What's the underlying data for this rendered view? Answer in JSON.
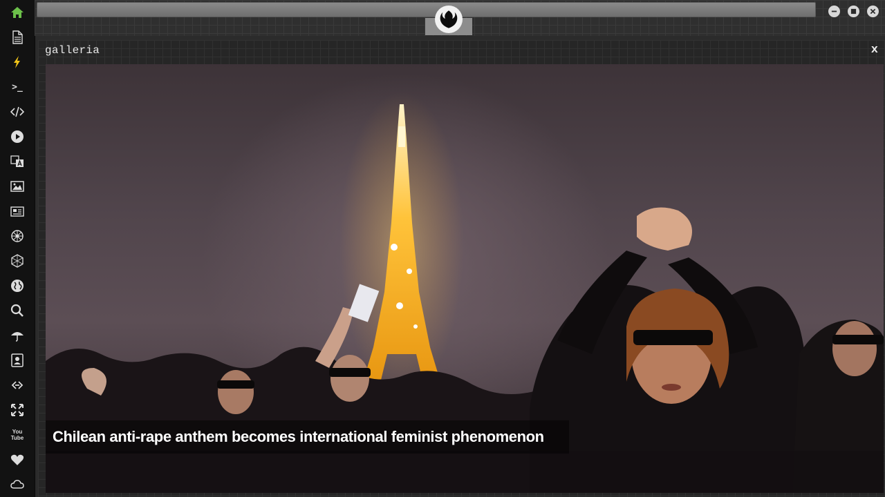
{
  "dock": {
    "items": [
      {
        "name": "home-icon",
        "active": true
      },
      {
        "name": "document-icon"
      },
      {
        "name": "lightning-icon"
      },
      {
        "name": "terminal-icon",
        "text": ">_"
      },
      {
        "name": "code-icon"
      },
      {
        "name": "play-icon"
      },
      {
        "name": "translate-icon"
      },
      {
        "name": "image-icon"
      },
      {
        "name": "newspaper-icon"
      },
      {
        "name": "settings-wheel-icon"
      },
      {
        "name": "hexagon-network-icon"
      },
      {
        "name": "globe-icon"
      },
      {
        "name": "search-icon"
      },
      {
        "name": "umbrella-icon"
      },
      {
        "name": "contact-card-icon"
      },
      {
        "name": "link-icon"
      },
      {
        "name": "fullscreen-icon"
      },
      {
        "name": "youtube-icon",
        "text": "You Tube"
      },
      {
        "name": "heart-icon"
      },
      {
        "name": "cloud-icon"
      }
    ],
    "accent": "#6cc04a"
  },
  "window": {
    "emblem": "rebel-alliance-icon"
  },
  "panel": {
    "title": "galleria",
    "close_label": "x"
  },
  "gallery": {
    "caption": "Chilean anti-rape anthem becomes international feminist phenomenon"
  }
}
